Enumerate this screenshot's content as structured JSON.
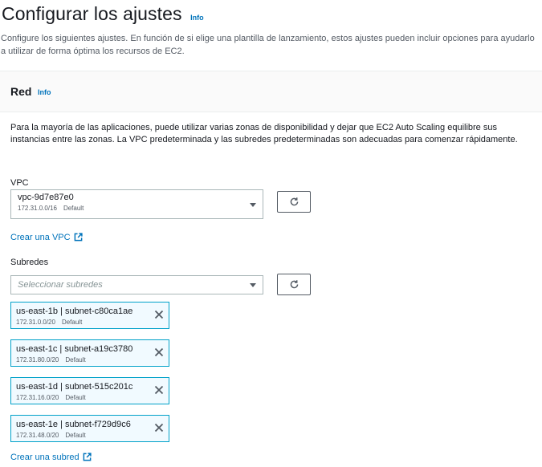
{
  "header": {
    "title": "Configurar los ajustes",
    "info_label": "Info",
    "description": "Configure los siguientes ajustes. En función de si elige una plantilla de lanzamiento, estos ajustes pueden incluir opciones para ayudarlo a utilizar de forma óptima los recursos de EC2."
  },
  "network": {
    "title": "Red",
    "info_label": "Info",
    "description": "Para la mayoría de las aplicaciones, puede utilizar varias zonas de disponibilidad y dejar que EC2 Auto Scaling equilibre sus instancias entre las zonas. La VPC predeterminada y las subredes predeterminadas son adecuadas para comenzar rápidamente.",
    "vpc": {
      "label": "VPC",
      "selected_value": "vpc-9d7e87e0",
      "cidr": "172.31.0.0/16",
      "tag": "Default",
      "create_link": "Crear una VPC"
    },
    "subnets": {
      "label": "Subredes",
      "placeholder": "Seleccionar subredes",
      "create_link": "Crear una subred",
      "selected": [
        {
          "name": "us-east-1b | subnet-c80ca1ae",
          "cidr": "172.31.0.0/20",
          "tag": "Default"
        },
        {
          "name": "us-east-1c | subnet-a19c3780",
          "cidr": "172.31.80.0/20",
          "tag": "Default"
        },
        {
          "name": "us-east-1d | subnet-515c201c",
          "cidr": "172.31.16.0/20",
          "tag": "Default"
        },
        {
          "name": "us-east-1e | subnet-f729d9c6",
          "cidr": "172.31.48.0/20",
          "tag": "Default"
        }
      ]
    }
  },
  "colors": {
    "link": "#0073bb",
    "token_border": "#00a1c9",
    "token_background": "#f1faff",
    "text": "#16191f",
    "muted_text": "#545b64"
  },
  "icons": {
    "refresh": "refresh-icon",
    "external_link": "external-link-icon",
    "remove": "close-icon",
    "dropdown": "caret-down-icon"
  }
}
